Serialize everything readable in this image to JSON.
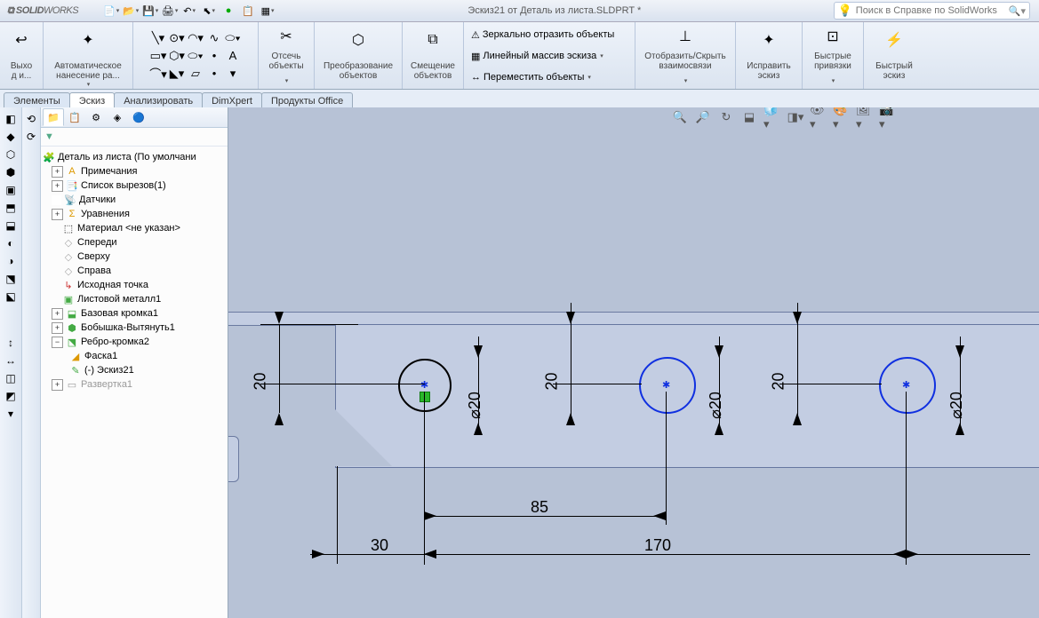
{
  "title": "Эскиз21 от Деталь из листа.SLDPRT *",
  "logo_prefix": "SOLID",
  "logo_suffix": "WORKS",
  "search_placeholder": "Поиск в Справке по SolidWorks",
  "ribbon": {
    "exit_l1": "Выхо",
    "exit_l2": "д и...",
    "autodim_l1": "Автоматическое",
    "autodim_l2": "нанесение ра...",
    "trim_l1": "Отсечь",
    "trim_l2": "объекты",
    "convert_l1": "Преобразование",
    "convert_l2": "объектов",
    "offset_l1": "Смещение",
    "offset_l2": "объектов",
    "mirror": "Зеркально отразить объекты",
    "pattern": "Линейный массив эскиза",
    "move": "Переместить объекты",
    "showrel_l1": "Отобразить/Скрыть",
    "showrel_l2": "взаимосвязи",
    "repair_l1": "Исправить",
    "repair_l2": "эскиз",
    "snaps_l1": "Быстрые",
    "snaps_l2": "привязки",
    "rapid_l1": "Быстрый",
    "rapid_l2": "эскиз"
  },
  "tabs": {
    "t1": "Элементы",
    "t2": "Эскиз",
    "t3": "Анализировать",
    "t4": "DimXpert",
    "t5": "Продукты Office"
  },
  "tree": {
    "root": "Деталь из листа  (По умолчани",
    "n1": "Примечания",
    "n2": "Список вырезов(1)",
    "n3": "Датчики",
    "n4": "Уравнения",
    "n5": "Материал <не указан>",
    "n6": "Спереди",
    "n7": "Сверху",
    "n8": "Справа",
    "n9": "Исходная точка",
    "n10": "Листовой металл1",
    "n11": "Базовая кромка1",
    "n12": "Бобышка-Вытянуть1",
    "n13": "Ребро-кромка2",
    "n14": "Фаска1",
    "n15": "(-) Эскиз21",
    "n16": "Развертка1"
  },
  "dims": {
    "v20_a": "20",
    "v20_b": "20",
    "v20_c": "20",
    "d20_a": "⌀20",
    "d20_b": "⌀20",
    "d20_c": "⌀20",
    "h85": "85",
    "h30": "30",
    "h170": "170"
  },
  "panel_chev": "»"
}
